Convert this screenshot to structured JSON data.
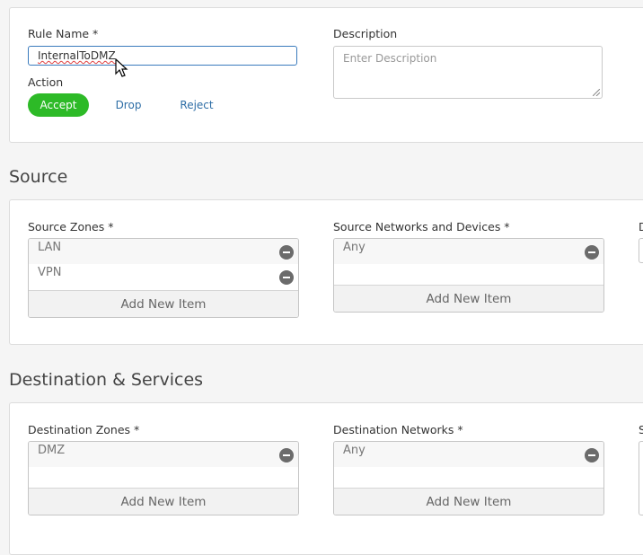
{
  "rule": {
    "name_label": "Rule Name *",
    "name_value": "InternalToDMZ",
    "description_label": "Description",
    "description_placeholder": "Enter Description",
    "action_label": "Action",
    "actions": [
      {
        "label": "Accept",
        "selected": true
      },
      {
        "label": "Drop",
        "selected": false
      },
      {
        "label": "Reject",
        "selected": false
      }
    ]
  },
  "source": {
    "title": "Source",
    "zones_label": "Source Zones *",
    "zones": [
      "LAN",
      "VPN"
    ],
    "networks_label": "Source Networks and Devices *",
    "networks": [
      "Any"
    ],
    "third_label_partial": "D"
  },
  "destination": {
    "title": "Destination & Services",
    "zones_label": "Destination Zones *",
    "zones": [
      "DMZ"
    ],
    "networks_label": "Destination Networks *",
    "networks": [
      "Any"
    ],
    "third_label_partial": "S"
  },
  "common": {
    "add_new_item": "Add New Item"
  },
  "colors": {
    "accept_green": "#2dba27",
    "link_blue": "#2e6ea6",
    "focus_border": "#3a7bbd"
  }
}
